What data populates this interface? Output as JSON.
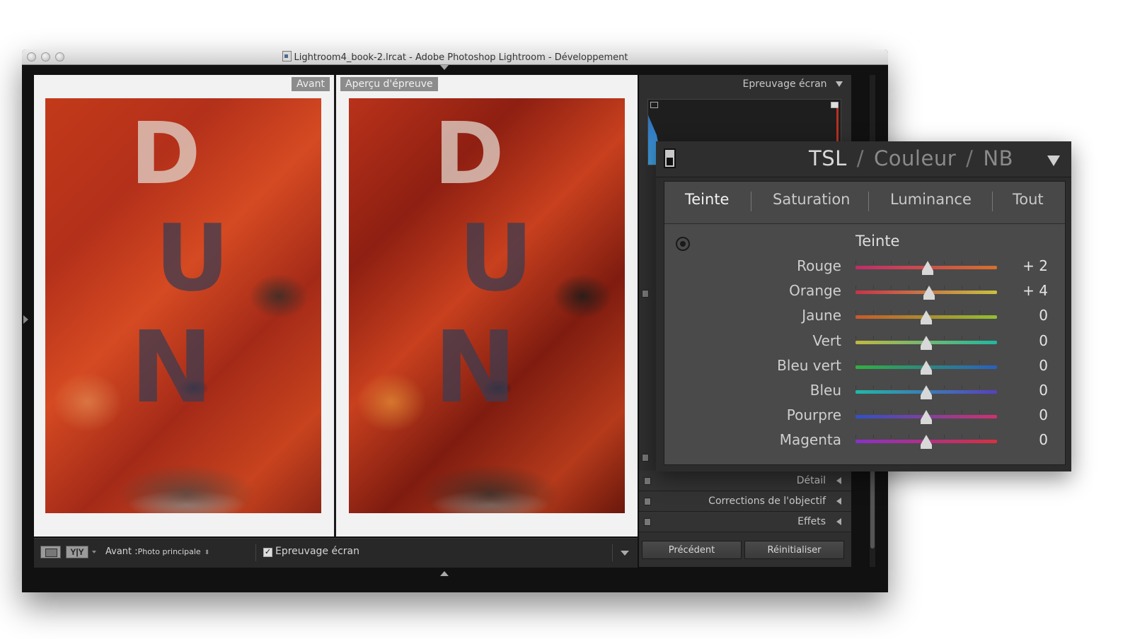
{
  "window": {
    "title": "Lightroom4_book-2.lrcat - Adobe Photoshop Lightroom - Développement"
  },
  "view": {
    "before_label": "Avant",
    "after_label": "Aperçu d'épreuve"
  },
  "toolbar": {
    "mode_label": "Y|Y",
    "before_prefix": "Avant :",
    "before_value": "Photo principale",
    "softproof_checkbox_checked": true,
    "softproof_label": "Epreuvage écran"
  },
  "right_panel": {
    "header_label": "Epreuvage écran",
    "sections": [
      {
        "label": "Détail"
      },
      {
        "label": "Corrections de l'objectif"
      },
      {
        "label": "Effets"
      }
    ],
    "previous_button": "Précédent",
    "reset_button": "Réinitialiser"
  },
  "tsl_panel": {
    "title_parts": [
      "TSL",
      "Couleur",
      "NB"
    ],
    "tabs": [
      "Teinte",
      "Saturation",
      "Luminance",
      "Tout"
    ],
    "active_tab": "Teinte",
    "section_title": "Teinte",
    "sliders": [
      {
        "label": "Rouge",
        "value": "+ 2",
        "position": 0.51,
        "track": [
          "#c02c6a",
          "#d6702c"
        ]
      },
      {
        "label": "Orange",
        "value": "+ 4",
        "position": 0.52,
        "track": [
          "#c8334a",
          "#c8c040"
        ]
      },
      {
        "label": "Jaune",
        "value": "0",
        "position": 0.5,
        "track": [
          "#c85a2a",
          "#90c030"
        ]
      },
      {
        "label": "Vert",
        "value": "0",
        "position": 0.5,
        "track": [
          "#c0b840",
          "#20b8a0"
        ]
      },
      {
        "label": "Bleu vert",
        "value": "0",
        "position": 0.5,
        "track": [
          "#30b040",
          "#2a60c0"
        ]
      },
      {
        "label": "Bleu",
        "value": "0",
        "position": 0.5,
        "track": [
          "#20b8a8",
          "#5840c0"
        ]
      },
      {
        "label": "Pourpre",
        "value": "0",
        "position": 0.5,
        "track": [
          "#3050c8",
          "#d03070"
        ]
      },
      {
        "label": "Magenta",
        "value": "0",
        "position": 0.5,
        "track": [
          "#8a30c8",
          "#d83040"
        ]
      }
    ]
  },
  "photo_text": {
    "letters_top": "D",
    "letters_mid": "U",
    "letters_low": "N"
  }
}
